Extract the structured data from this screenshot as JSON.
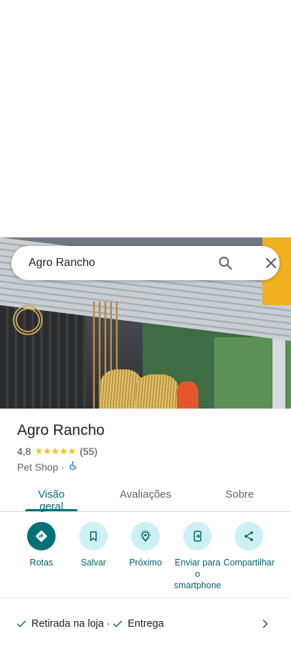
{
  "search": {
    "query": "Agro Rancho"
  },
  "place": {
    "name": "Agro Rancho",
    "rating": "4,8",
    "stars": "★★★★★",
    "review_count": "(55)",
    "category": "Pet Shop",
    "separator": "·"
  },
  "tabs": [
    {
      "label": "Visão geral",
      "active": true
    },
    {
      "label": "Avaliações",
      "active": false
    },
    {
      "label": "Sobre",
      "active": false
    }
  ],
  "actions": [
    {
      "label": "Rotas",
      "icon": "directions-icon"
    },
    {
      "label": "Salvar",
      "icon": "bookmark-icon"
    },
    {
      "label": "Próximo",
      "icon": "nearby-icon"
    },
    {
      "label": "Enviar para o smartphone",
      "icon": "send-to-phone-icon"
    },
    {
      "label": "Compartilhar",
      "icon": "share-icon"
    }
  ],
  "services": [
    {
      "label": "Retirada na loja ·"
    },
    {
      "label": "Entrega"
    }
  ],
  "colors": {
    "accent": "#00707a",
    "chip": "#cdf0f4",
    "star": "#fbbc04",
    "check": "#188038"
  }
}
